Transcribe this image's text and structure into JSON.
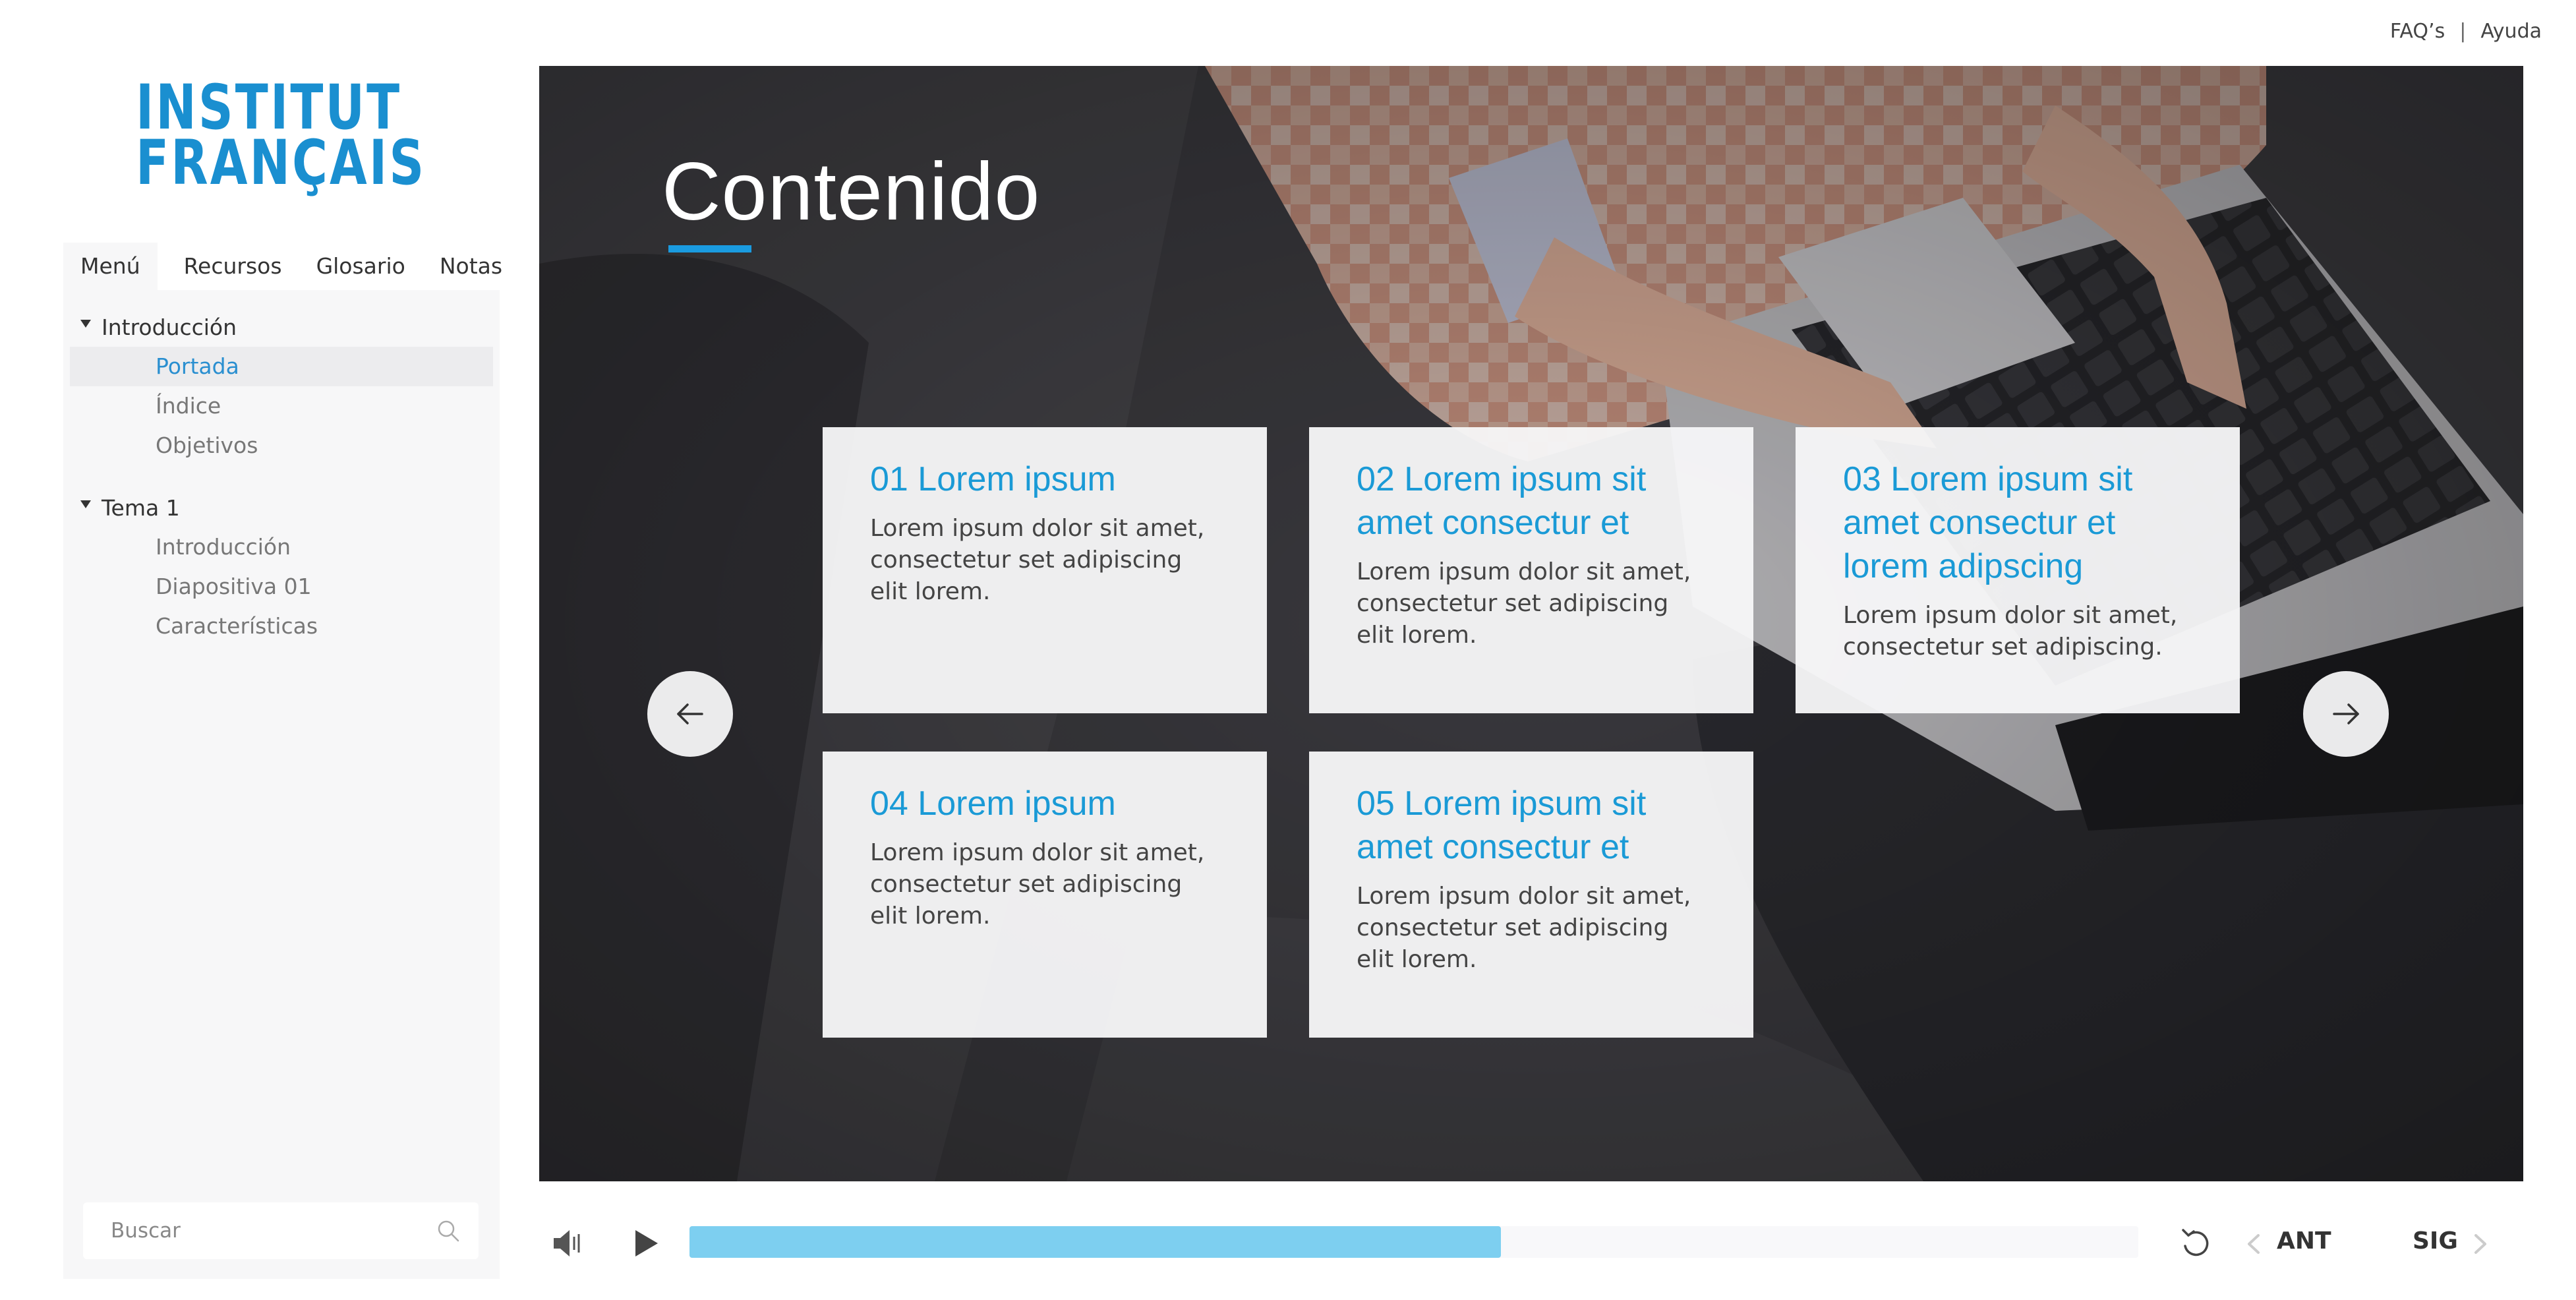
{
  "top_links": {
    "faq": "FAQ’s",
    "separator": "|",
    "help": "Ayuda"
  },
  "logo": {
    "line1": "INSTITUT",
    "line2": "FRANÇAIS",
    "color": "#1a8fd0"
  },
  "sidebar": {
    "tabs": [
      {
        "label": "Menú",
        "active": true
      },
      {
        "label": "Recursos"
      },
      {
        "label": "Glosario"
      },
      {
        "label": "Notas"
      }
    ],
    "sections": [
      {
        "label": "Introducción",
        "items": [
          {
            "label": "Portada",
            "active": true
          },
          {
            "label": "Índice"
          },
          {
            "label": "Objetivos"
          }
        ]
      },
      {
        "label": "Tema 1",
        "items": [
          {
            "label": "Introducción"
          },
          {
            "label": "Diapositiva 01"
          },
          {
            "label": "Características"
          }
        ]
      }
    ],
    "search": {
      "placeholder": "Buscar",
      "icon": "search-icon"
    }
  },
  "stage": {
    "title": "Contenido",
    "accent_color": "#1a9be0",
    "cards": [
      {
        "title": "01 Lorem ipsum",
        "body": "Lorem ipsum dolor sit amet, consectetur set adipiscing elit lorem."
      },
      {
        "title": "02 Lorem ipsum sit amet consectur et",
        "body": "Lorem ipsum dolor sit amet, consectetur set adipiscing elit lorem."
      },
      {
        "title": "03 Lorem ipsum sit amet consectur et lorem adipscing",
        "body": "Lorem ipsum dolor sit amet, consectetur set adipiscing."
      },
      {
        "title": "04 Lorem ipsum",
        "body": "Lorem ipsum dolor sit amet, consectetur set adipiscing elit lorem."
      },
      {
        "title": "05 Lorem ipsum sit amet consectur et",
        "body": "Lorem ipsum dolor sit amet, consectetur set adipiscing elit lorem."
      }
    ],
    "prev_icon": "arrow-left-icon",
    "next_icon": "arrow-right-icon"
  },
  "player": {
    "volume_icon": "volume-icon",
    "play_icon": "play-icon",
    "progress_fraction": 0.56,
    "progress_color": "#7dcff0",
    "replay_icon": "replay-icon",
    "prev_label": "ANT",
    "next_label": "SIG"
  }
}
